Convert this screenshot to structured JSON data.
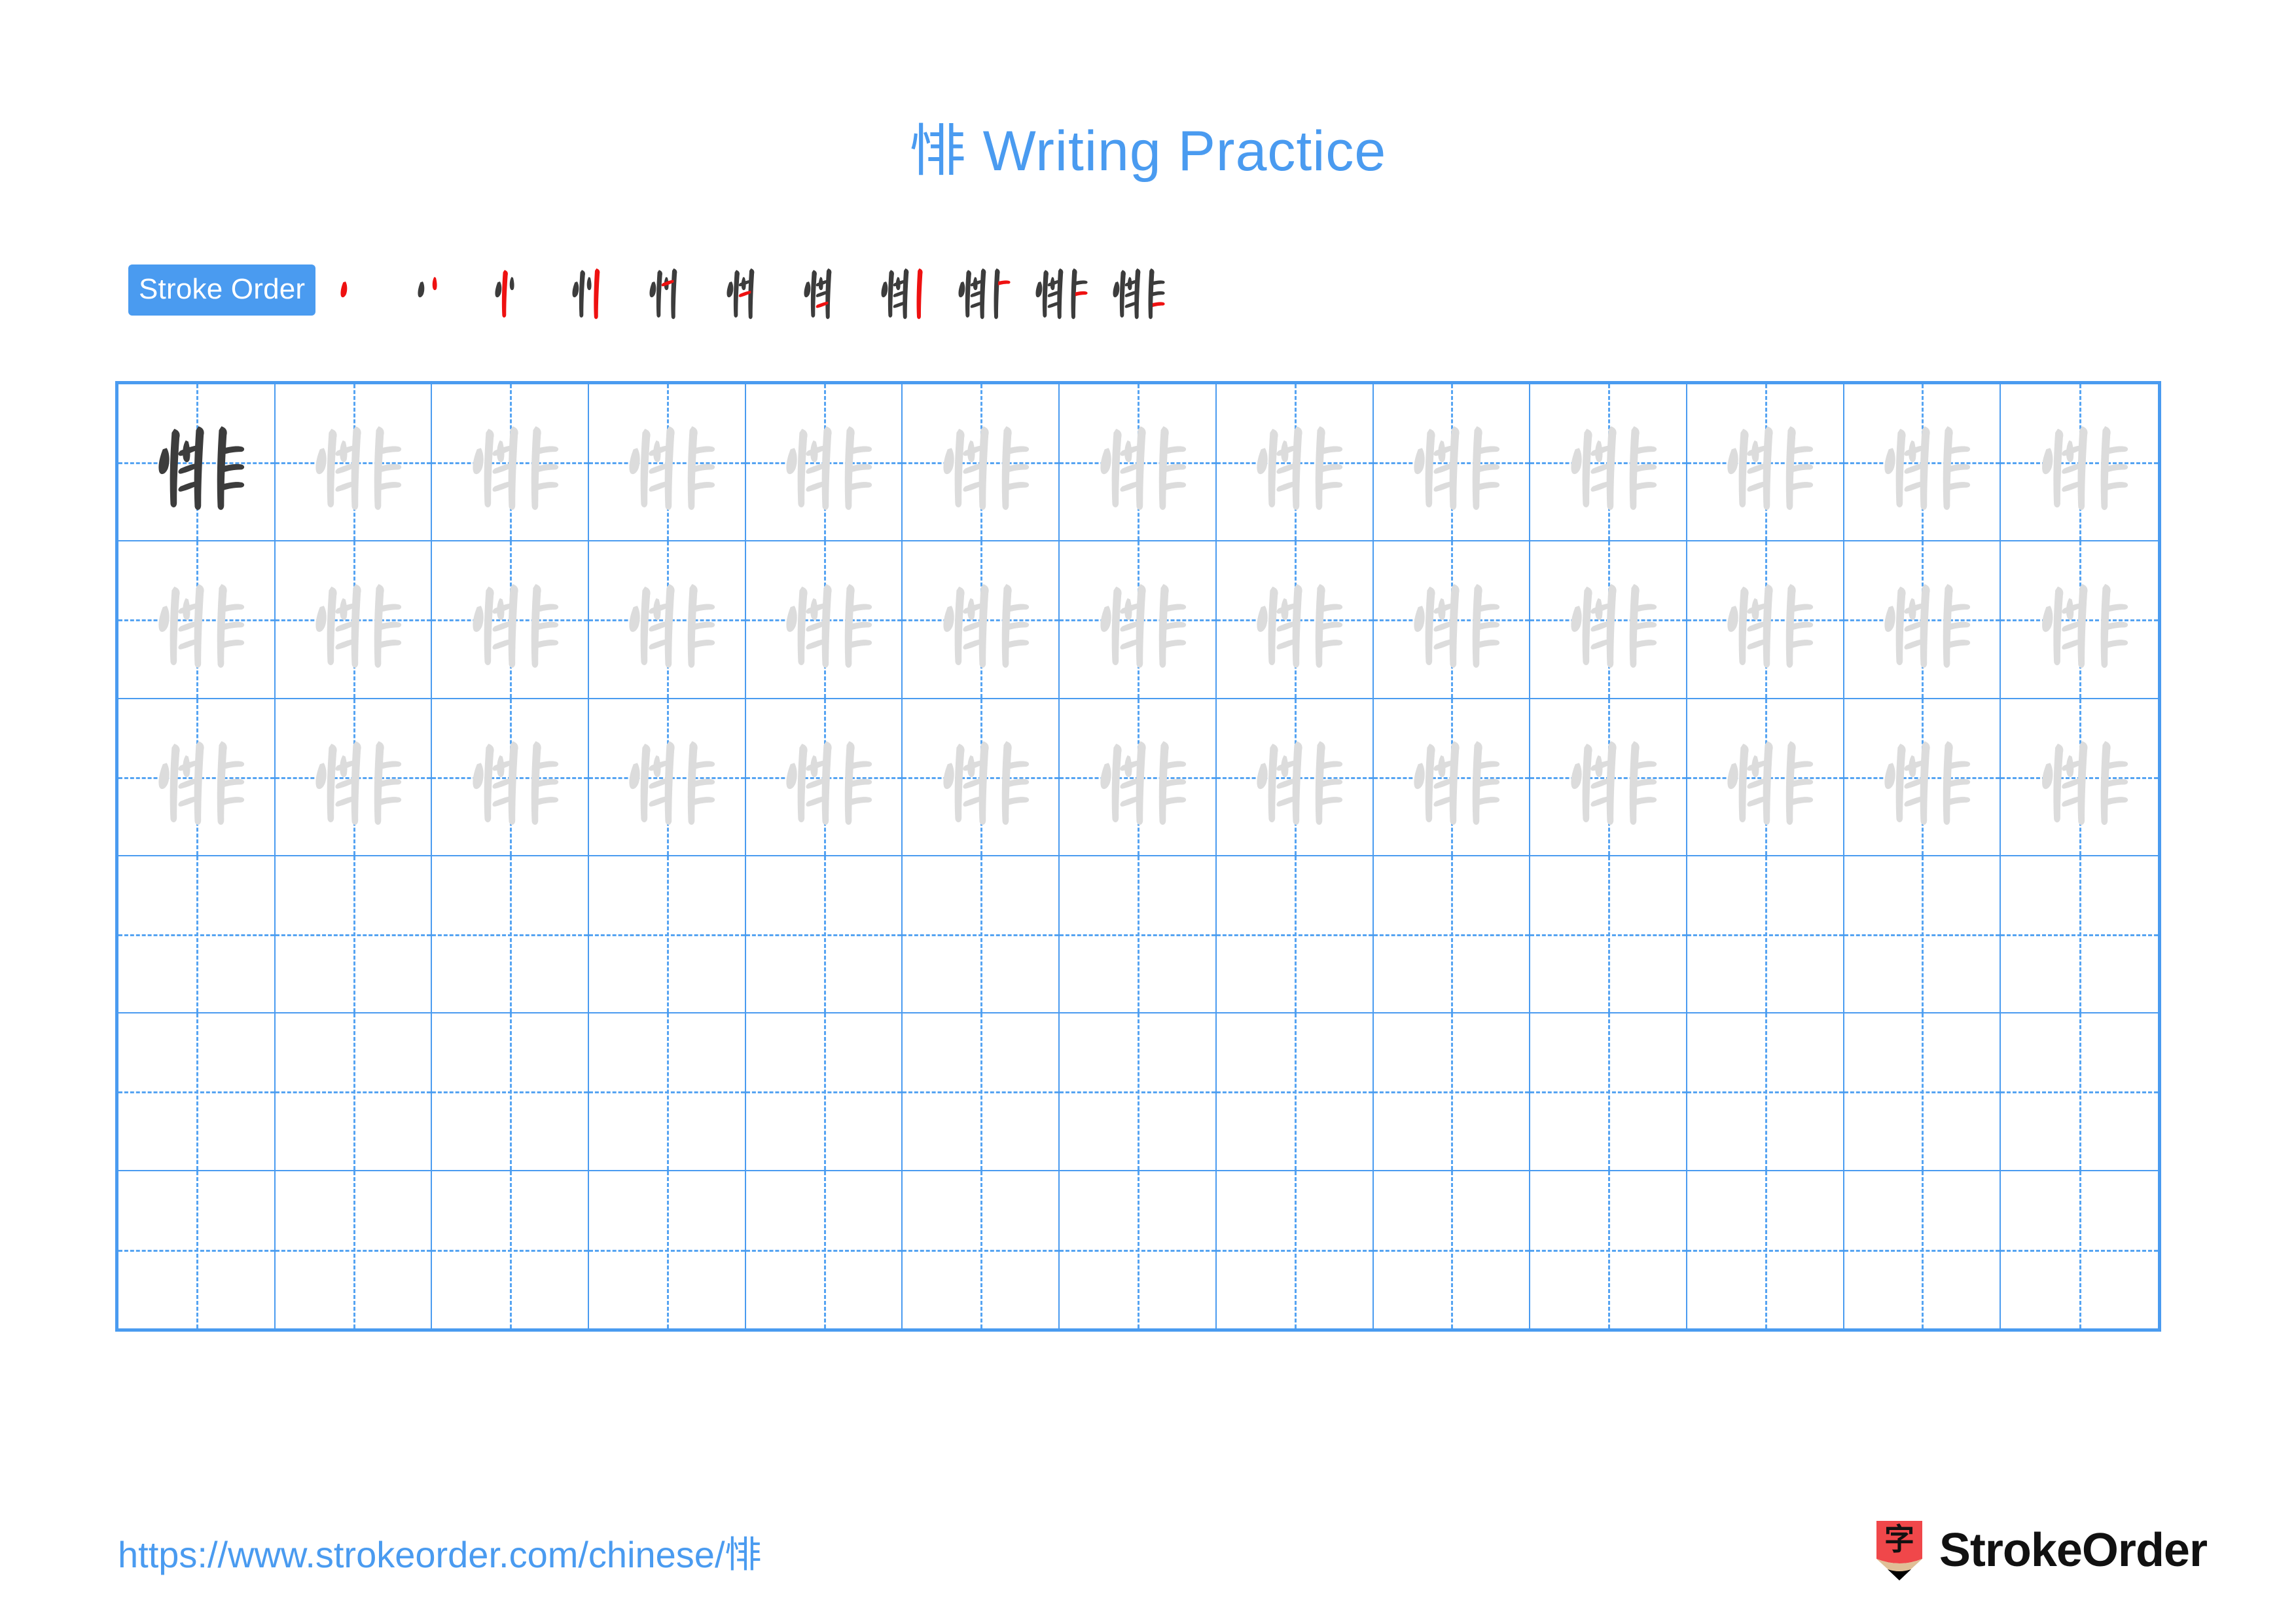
{
  "page": {
    "character": "悱",
    "title_suffix": " Writing Practice",
    "title_full": "悱 Writing Practice",
    "accent_color": "#4a9bf0",
    "grid_line_color": "#4a9bf0",
    "guide_line_color": "#56a4f2",
    "model_char_color": "#3c3c3c",
    "trace_char_color": "#dcdcdc",
    "stroke_new_color": "#ee1111",
    "stroke_done_color": "#3c3c3c",
    "background_color": "#ffffff"
  },
  "stroke_order": {
    "badge_label": "Stroke Order",
    "total_strokes": 11,
    "steps": [
      1,
      2,
      3,
      4,
      5,
      6,
      7,
      8,
      9,
      10,
      11
    ]
  },
  "grid": {
    "columns": 13,
    "rows": 6,
    "filled_rows": 3,
    "empty_rows": 3,
    "model_cell_index": 0
  },
  "footer": {
    "url": "https://www.strokeorder.com/chinese/悱",
    "brand_name": "StrokeOrder",
    "brand_mark_char": "字",
    "brand_mark_body_color": "#f0474a",
    "brand_mark_tip_color": "#e0bf96",
    "brand_mark_point_color": "#000000"
  }
}
